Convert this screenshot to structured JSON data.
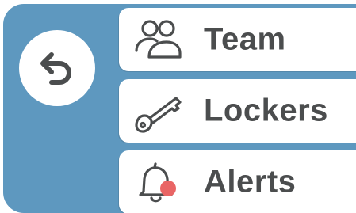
{
  "menu": {
    "items": [
      {
        "label": "Team",
        "icon": "team-icon"
      },
      {
        "label": "Lockers",
        "icon": "key-icon"
      },
      {
        "label": "Alerts",
        "icon": "bell-icon"
      }
    ]
  },
  "back": {
    "icon": "back-arrow-icon"
  },
  "colors": {
    "panel": "#5e98bf",
    "card": "#ffffff",
    "text": "#4b4d4e",
    "alert_dot": "#e96565"
  }
}
